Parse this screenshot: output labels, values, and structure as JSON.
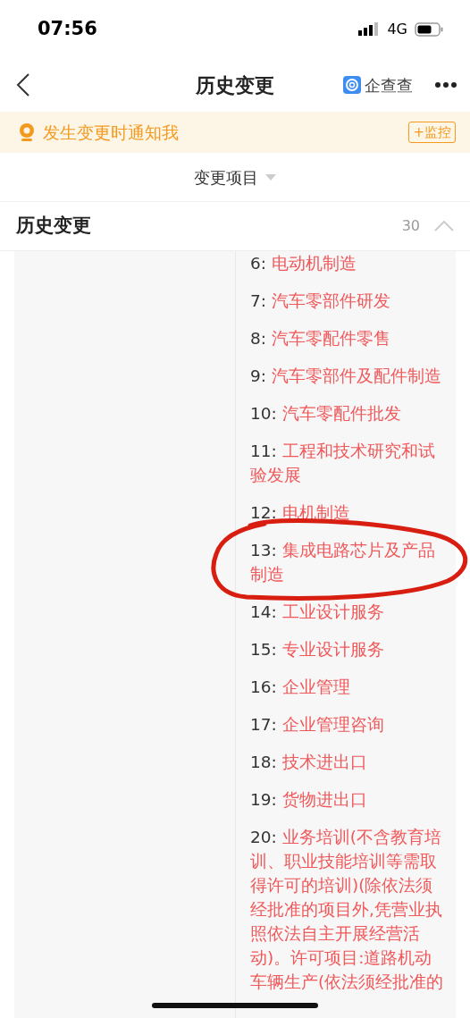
{
  "status_bar": {
    "time": "07:56",
    "network": "4G"
  },
  "nav": {
    "title": "历史变更",
    "brand": "企查查"
  },
  "notice": {
    "text": "发生变更时通知我",
    "button": "+监控"
  },
  "filter": {
    "label": "变更项目"
  },
  "section": {
    "title": "历史变更",
    "count": "30",
    "expanded": true
  },
  "items": [
    {
      "number": "6:",
      "text": "电动机制造",
      "circled": false
    },
    {
      "number": "7:",
      "text": "汽车零部件研发",
      "circled": false
    },
    {
      "number": "8:",
      "text": "汽车零配件零售",
      "circled": false
    },
    {
      "number": "9:",
      "text": "汽车零部件及配件制造",
      "circled": false
    },
    {
      "number": "10:",
      "text": "汽车零配件批发",
      "circled": false
    },
    {
      "number": "11:",
      "text": "工程和技术研究和试验发展",
      "circled": false
    },
    {
      "number": "12:",
      "text": "电机制造",
      "circled": false
    },
    {
      "number": "13:",
      "text": "集成电路芯片及产品制造",
      "circled": true
    },
    {
      "number": "14:",
      "text": "工业设计服务",
      "circled": false
    },
    {
      "number": "15:",
      "text": "专业设计服务",
      "circled": false
    },
    {
      "number": "16:",
      "text": "企业管理",
      "circled": false
    },
    {
      "number": "17:",
      "text": "企业管理咨询",
      "circled": false
    },
    {
      "number": "18:",
      "text": "技术进出口",
      "circled": false
    },
    {
      "number": "19:",
      "text": "货物进出口",
      "circled": false
    },
    {
      "number": "20:",
      "text": "业务培训(不含教育培训、职业技能培训等需取得许可的培训)(除依法须经批准的项目外,凭营业执照依法自主开展经营活动)。许可项目:道路机动车辆生产(依法须经批准的",
      "circled": false
    }
  ]
}
